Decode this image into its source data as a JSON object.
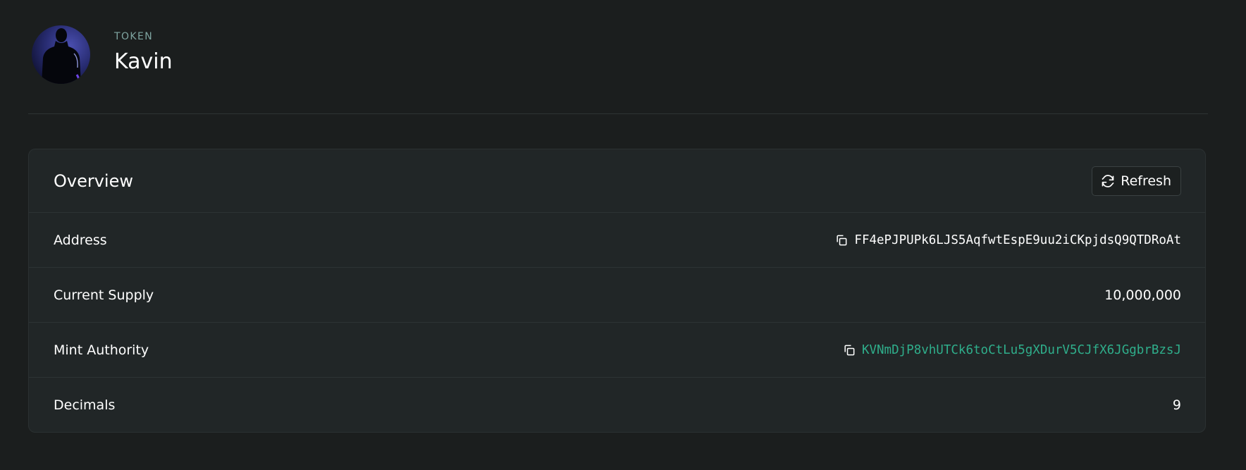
{
  "header": {
    "eyebrow": "TOKEN",
    "name": "Kavin",
    "avatar_icon": "person-silhouette-avatar"
  },
  "overview": {
    "title": "Overview",
    "refresh_label": "Refresh",
    "refresh_icon": "refresh-icon",
    "rows": [
      {
        "label": "Address",
        "value": "FF4ePJPUPk6LJS5AqfwtEspE9uu2iCKpjdsQ9QTDRoAt",
        "copyable": true,
        "link": false
      },
      {
        "label": "Current Supply",
        "value": "10,000,000",
        "copyable": false,
        "link": false
      },
      {
        "label": "Mint Authority",
        "value": "KVNmDjP8vhUTCk6toCtLu5gXDurV5CJfX6JGgbrBzsJ",
        "copyable": true,
        "link": true
      },
      {
        "label": "Decimals",
        "value": "9",
        "copyable": false,
        "link": false
      }
    ]
  },
  "colors": {
    "background": "#1b1e1e",
    "card": "#212627",
    "accent_link": "#2fae8b",
    "eyebrow": "#7fa5a1"
  }
}
